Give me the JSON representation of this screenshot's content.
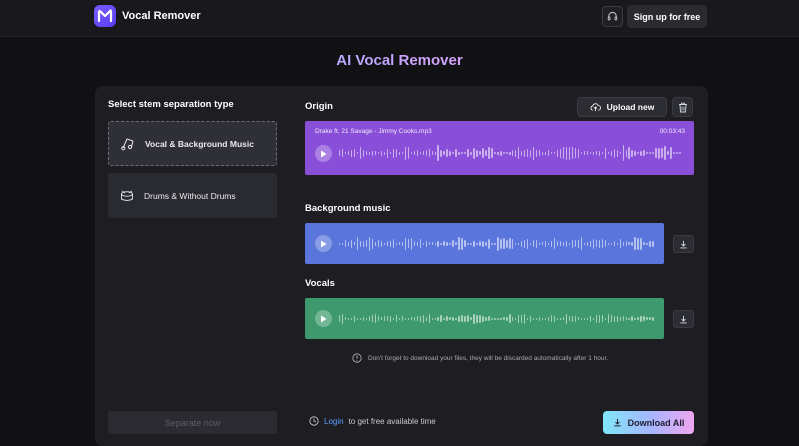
{
  "app": {
    "title": "Vocal Remover",
    "signup_label": "Sign up for free",
    "support_icon": "headset-icon"
  },
  "headline": "AI Vocal Remover",
  "stem_panel": {
    "title": "Select stem separation type",
    "options": [
      {
        "label": "Vocal & Background Music",
        "icon": "music-notes-icon",
        "selected": true
      },
      {
        "label": "Drums & Without Drums",
        "icon": "drum-icon",
        "selected": false
      }
    ],
    "separate_label": "Separate now"
  },
  "origin": {
    "title": "Origin",
    "upload_label": "Upload new",
    "file_name": "Drake ft. 21 Savage - Jimmy Cooks.mp3",
    "duration": "00:03:43"
  },
  "background_music": {
    "title": "Background music"
  },
  "vocals": {
    "title": "Vocals"
  },
  "notice": "Don't forget to download your files, they will be discarded automatically after 1 hour.",
  "footer": {
    "login_link": "Login",
    "login_text": "to get free available time",
    "download_all_label": "Download All"
  },
  "colors": {
    "origin_track": "#8a4fd8",
    "music_track": "#5a75dc",
    "vocals_track": "#3e9a6e",
    "accent": "#6b4cf0"
  }
}
